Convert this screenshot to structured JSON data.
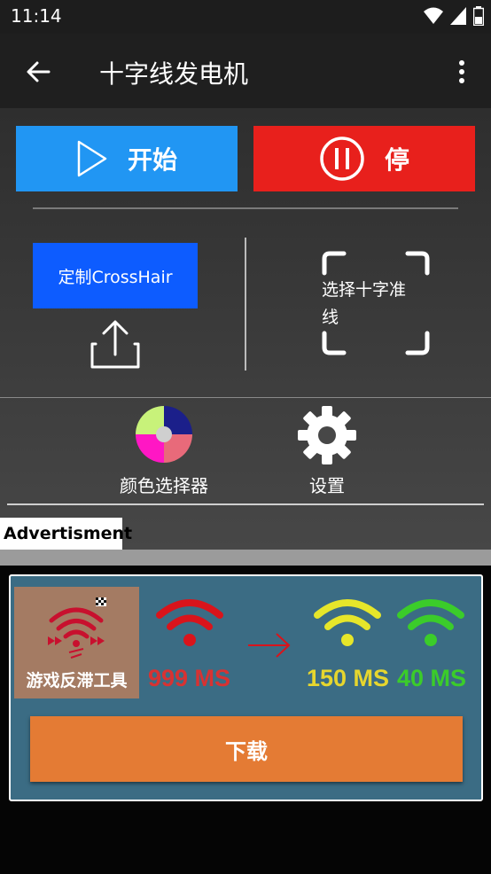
{
  "status_bar": {
    "time": "11:14"
  },
  "app_bar": {
    "title": "十字线发电机"
  },
  "controls": {
    "start_label": "开始",
    "stop_label": "停",
    "custom_label": "定制CrossHair",
    "select_label": "选择十字准线"
  },
  "tools": {
    "color_picker_label": "颜色选择器",
    "settings_label": "设置"
  },
  "ad": {
    "tag": "Advertisment",
    "app_name": "游戏反滞工具",
    "ping_values": [
      "999 MS",
      "150 MS",
      "40 MS"
    ],
    "download_label": "下载"
  },
  "colors": {
    "start": "#2196f3",
    "stop": "#e8201c",
    "custom": "#0d5cff",
    "download": "#e47b34",
    "banner": "#3b6c84"
  }
}
